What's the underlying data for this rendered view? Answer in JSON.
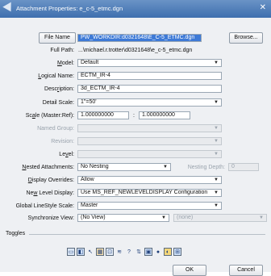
{
  "window": {
    "title": "Attachment Properties: e_c-5_etmc.dgn",
    "close": "✕"
  },
  "file_name": {
    "label": "File Name",
    "value": "PW_WORKDIR:d0321648\\E_C-5_ETMC.dgn",
    "browse": "Browse..."
  },
  "full_path": {
    "label": "Full Path:",
    "value": "...\\michael.r.trotter\\d0321648\\e_c-5_etmc.dgn"
  },
  "model": {
    "label": "Model:",
    "value": "Default"
  },
  "logical_name": {
    "label": "Logical Name:",
    "value": "ECTM_IR-4"
  },
  "description": {
    "label": "Description:",
    "value": "3d_ECTM_IR-4"
  },
  "detail_scale": {
    "label": "Detail Scale:",
    "value": "1\"=50'"
  },
  "scale": {
    "label": "Scale (Master:Ref):",
    "master": "1.000000000",
    "separator": ":",
    "ref": "1.000000000"
  },
  "named_group": {
    "label": "Named Group:",
    "value": ""
  },
  "revision": {
    "label": "Revision:",
    "value": ""
  },
  "level": {
    "label": "Level:",
    "value": ""
  },
  "nested_attachments": {
    "label": "Nested Attachments:",
    "value": "No Nesting",
    "depth_label": "Nesting Depth:",
    "depth_value": "0"
  },
  "display_overrides": {
    "label": "Display Overrides:",
    "value": "Allow"
  },
  "new_level_display": {
    "label": "New Level Display:",
    "value": "Use MS_REF_NEWLEVELDISPLAY Configuration"
  },
  "global_linestyle": {
    "label": "Global LineStyle Scale:",
    "value": "Master"
  },
  "synchronize_view": {
    "label": "Synchronize View:",
    "value": "(No View)",
    "second": "(none)"
  },
  "toggles": {
    "label": "Toggles"
  },
  "toolbar_icons": [
    "display-icon",
    "snap-icon",
    "locate-icon",
    "raster-icon",
    "clip-icon",
    "ignore-icon",
    "mask-icon",
    "level-icon",
    "boundary-icon",
    "color-icon",
    "shade-icon",
    "truescale-icon"
  ],
  "buttons": {
    "ok": "OK",
    "cancel": "Cancel"
  }
}
